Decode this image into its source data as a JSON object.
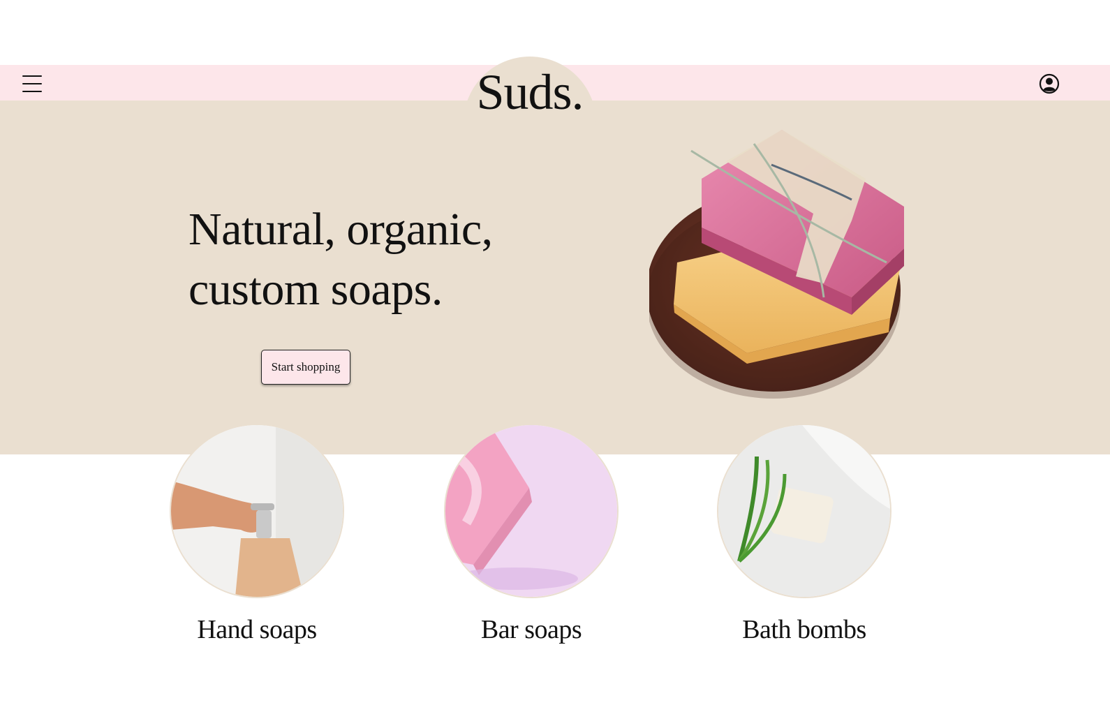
{
  "header": {
    "menu_icon": "hamburger-menu-icon",
    "account_icon": "user-circle-icon",
    "brand": "Suds."
  },
  "hero": {
    "headline_line1": "Natural, organic,",
    "headline_line2": "custom soaps.",
    "cta_label": "Start shopping",
    "image": "stacked-soap-bars-on-wooden-dish"
  },
  "categories": [
    {
      "label": "Hand soaps",
      "image": "hand-pressing-soap-dispenser"
    },
    {
      "label": "Bar soaps",
      "image": "pink-soap-bar-on-lilac"
    },
    {
      "label": "Bath bombs",
      "image": "white-soap-with-green-leaves"
    }
  ],
  "colors": {
    "topbar": "#fde6ea",
    "hero_bg": "#eadfd0",
    "button_bg": "#fde6ea",
    "text": "#111111"
  }
}
